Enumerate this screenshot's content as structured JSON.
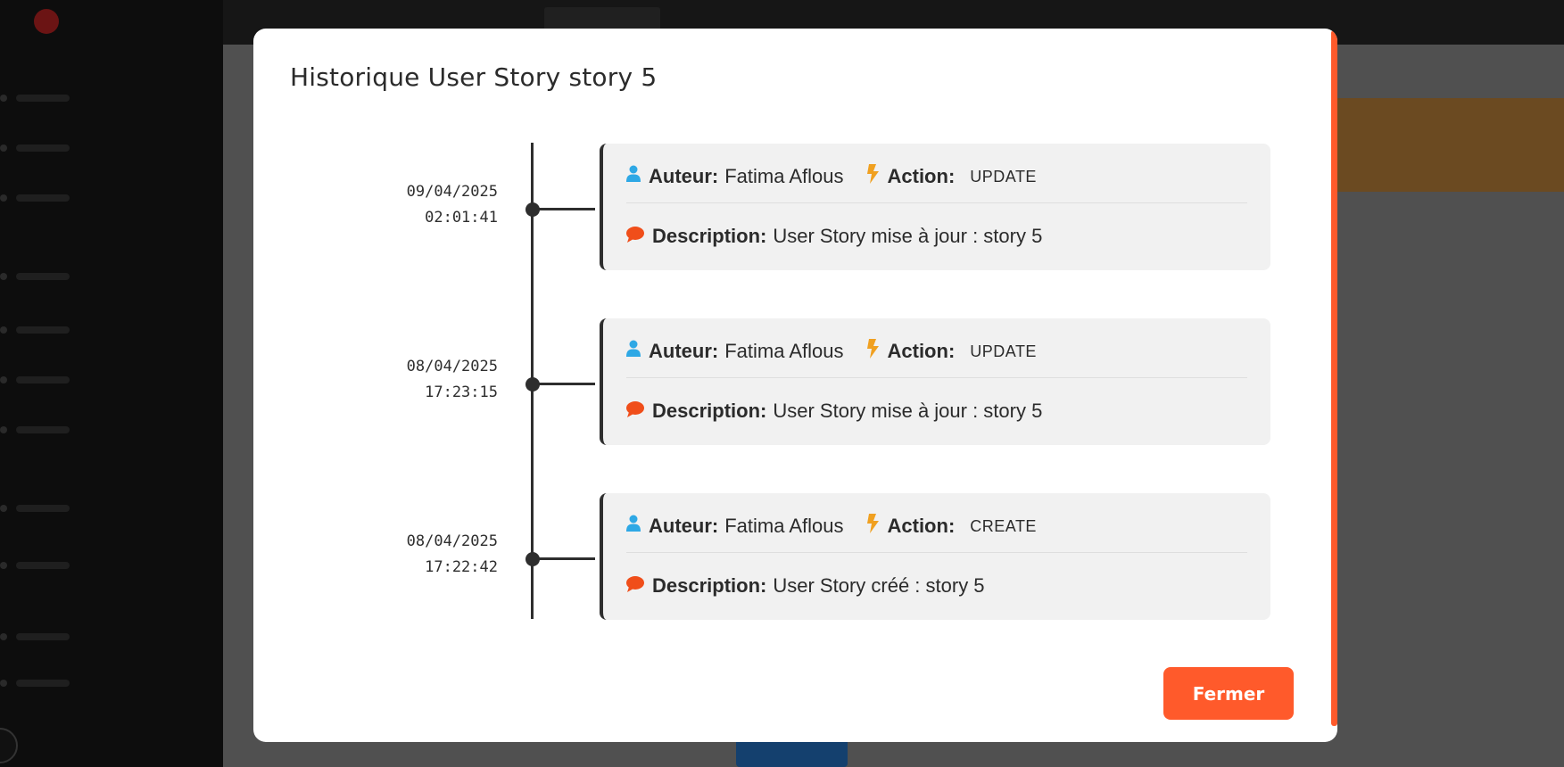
{
  "modal": {
    "title": "Historique User Story story 5",
    "close_label": "Fermer"
  },
  "labels": {
    "author": "Auteur:",
    "action": "Action:",
    "description": "Description:"
  },
  "entries": [
    {
      "date": "09/04/2025",
      "time": "02:01:41",
      "author": "Fatima Aflous",
      "action": "UPDATE",
      "description": "User Story mise à jour : story 5"
    },
    {
      "date": "08/04/2025",
      "time": "17:23:15",
      "author": "Fatima Aflous",
      "action": "UPDATE",
      "description": "User Story mise à jour : story 5"
    },
    {
      "date": "08/04/2025",
      "time": "17:22:42",
      "author": "Fatima Aflous",
      "action": "CREATE",
      "description": "User Story créé : story 5"
    }
  ],
  "colors": {
    "accent": "#ff5a2b",
    "user_icon": "#2ea8e5",
    "bolt_icon": "#f0a020",
    "comment_icon": "#f04e1a",
    "timeline": "#2e2e2e",
    "card_bg": "#f1f1f1"
  },
  "icons": {
    "author": "user-icon",
    "action": "bolt-icon",
    "description": "comment-icon"
  }
}
